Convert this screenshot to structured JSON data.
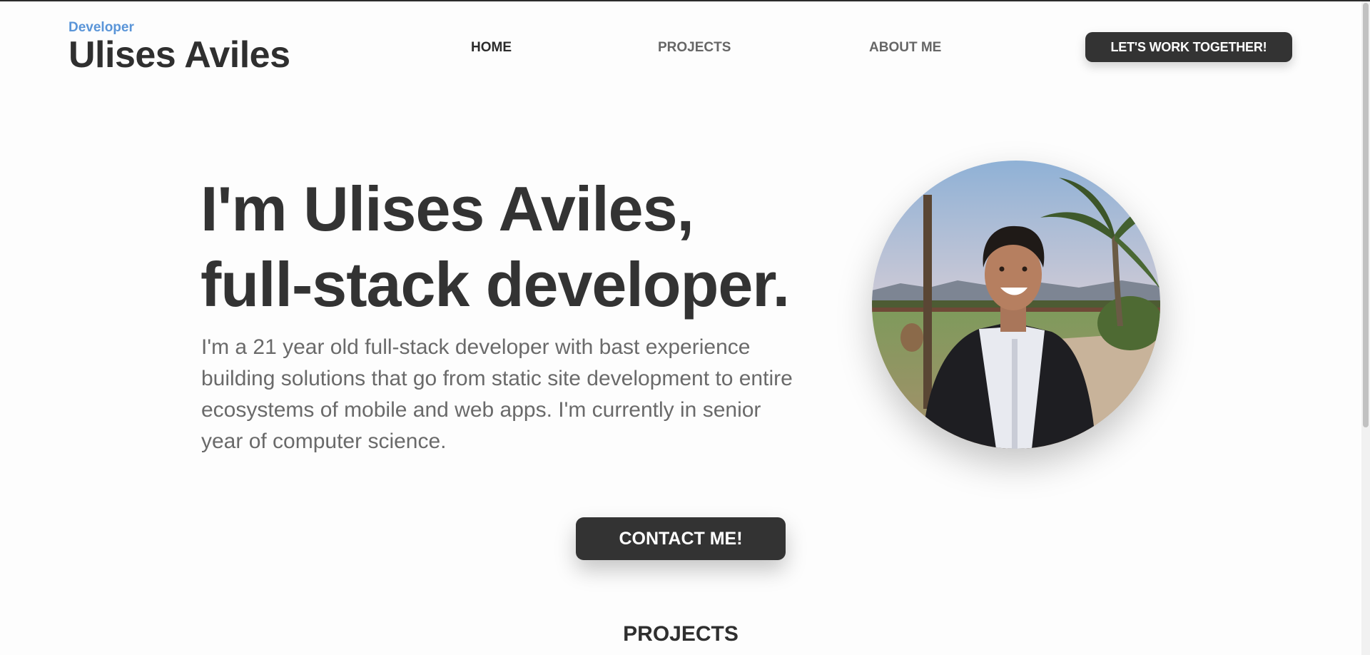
{
  "header": {
    "kicker": "Developer",
    "name": "Ulises Aviles"
  },
  "nav": {
    "items": [
      {
        "label": "HOME",
        "active": true
      },
      {
        "label": "PROJECTS",
        "active": false
      },
      {
        "label": "ABOUT ME",
        "active": false
      }
    ],
    "cta_label": "LET'S WORK TOGETHER!"
  },
  "hero": {
    "title_line1": "I'm Ulises Aviles,",
    "title_line2": "full-stack developer.",
    "description": "I'm a 21 year old full-stack developer with bast experience building solutions that go from static site development to entire ecosystems of mobile and web apps. I'm currently in senior year of computer science.",
    "cta_label": "CONTACT ME!",
    "photo_icon": "profile-photo"
  },
  "sections": {
    "projects_title": "PROJECTS"
  },
  "colors": {
    "accent": "#5a95d8",
    "text_dark": "#333333",
    "text_muted": "#6a6a6a",
    "button_bg": "#333333",
    "button_text": "#ffffff",
    "background": "#fdfdfd"
  }
}
